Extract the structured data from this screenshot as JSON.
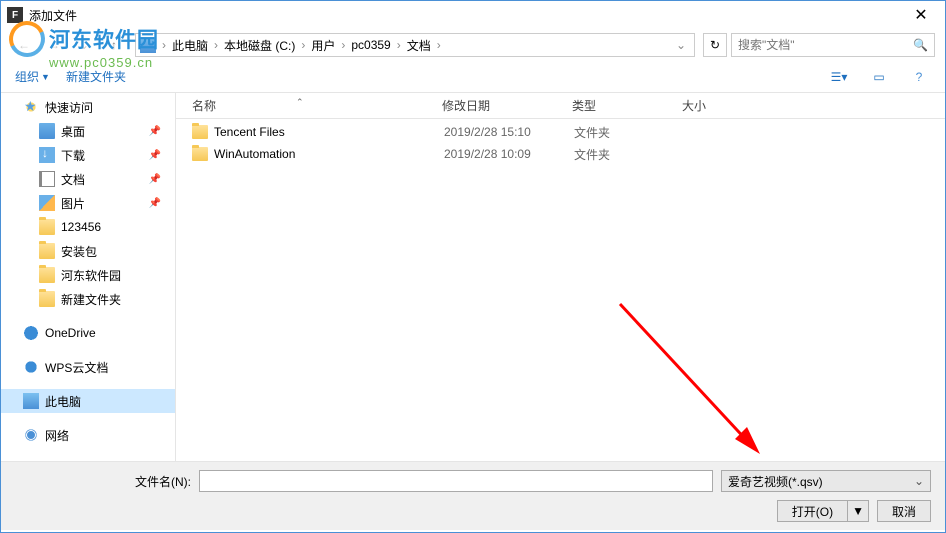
{
  "window": {
    "title": "添加文件"
  },
  "watermark": {
    "text": "河东软件园",
    "url": "www.pc0359.cn"
  },
  "breadcrumb": {
    "items": [
      "此电脑",
      "本地磁盘 (C:)",
      "用户",
      "pc0359",
      "文档"
    ]
  },
  "search": {
    "placeholder": "搜索\"文档\""
  },
  "toolbar": {
    "organize": "组织",
    "new_folder": "新建文件夹"
  },
  "sidebar": {
    "quick_access": "快速访问",
    "desktop": "桌面",
    "downloads": "下载",
    "documents": "文档",
    "pictures": "图片",
    "f123456": "123456",
    "install": "安装包",
    "hedong": "河东软件园",
    "newfolder": "新建文件夹",
    "onedrive": "OneDrive",
    "wps": "WPS云文档",
    "thispc": "此电脑",
    "network": "网络"
  },
  "columns": {
    "name": "名称",
    "date": "修改日期",
    "type": "类型",
    "size": "大小"
  },
  "files": [
    {
      "name": "Tencent Files",
      "date": "2019/2/28 15:10",
      "type": "文件夹"
    },
    {
      "name": "WinAutomation",
      "date": "2019/2/28 10:09",
      "type": "文件夹"
    }
  ],
  "footer": {
    "filename_label": "文件名(N):",
    "filename_value": "",
    "filter": "爱奇艺视频(*.qsv)",
    "open": "打开(O)",
    "cancel": "取消"
  }
}
